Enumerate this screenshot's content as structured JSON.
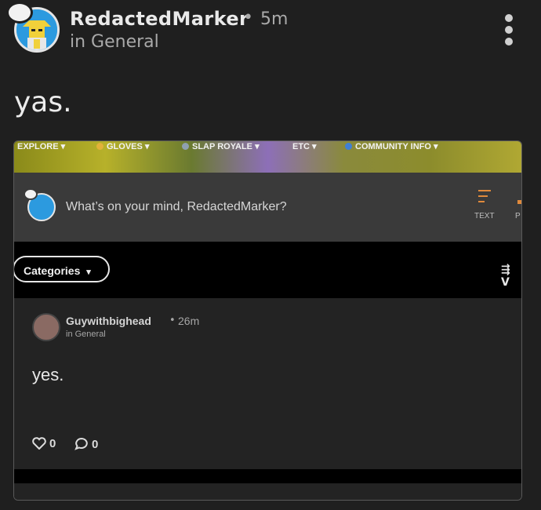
{
  "post": {
    "author": "RedactedMarker",
    "separator": "•",
    "time": "5m",
    "category": "in General",
    "body": "yas."
  },
  "screenshot": {
    "nav": [
      {
        "label": "EXPLORE ▾",
        "icon": "none"
      },
      {
        "label": "GLOVES ▾",
        "icon": "glove-icon"
      },
      {
        "label": "SLAP ROYALE ▾",
        "icon": "swords-icon"
      },
      {
        "label": "ETC ▾",
        "icon": "none"
      },
      {
        "label": "COMMUNITY INFO ▾",
        "icon": "user-icon"
      }
    ],
    "compose_prompt": "What’s on your mind, RedactedMarker?",
    "compose_text_label": "TEXT",
    "compose_p_label": "P",
    "categories_label": "Categories",
    "categories_caret": "▾",
    "filter_label": "⇶ V",
    "inner_post": {
      "author": "Guywithbighead",
      "separator": "•",
      "time": "26m",
      "category": "in General",
      "body": "yes.",
      "likes": "0",
      "comments": "0"
    }
  },
  "colors": {
    "background": "#1f1f1f",
    "accent_orange": "#e08a3c",
    "avatar_blue": "#2c9adf"
  }
}
